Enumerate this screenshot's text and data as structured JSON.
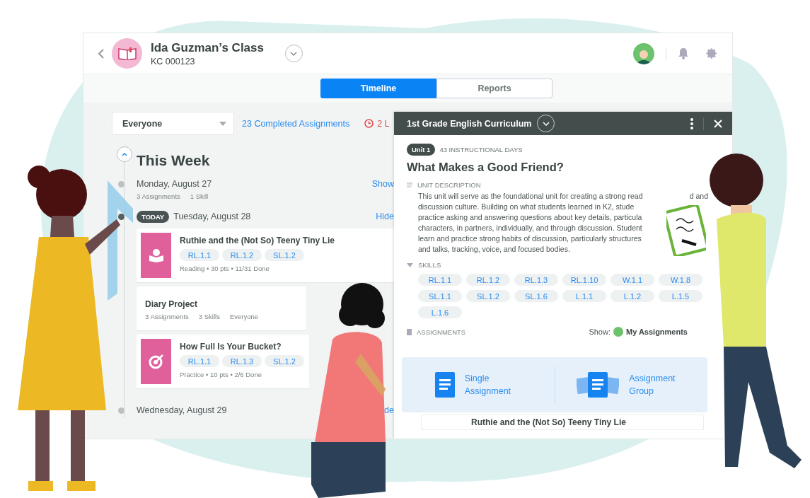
{
  "header": {
    "title": "Ida Guzman’s Class",
    "code": "KC 000123"
  },
  "tabs": [
    {
      "label": "Timeline",
      "selected": true
    },
    {
      "label": "Reports",
      "selected": false
    }
  ],
  "filter": {
    "value": "Everyone"
  },
  "completed_link": "23 Completed Assignments",
  "late_count": "2 L",
  "timeline": {
    "heading": "This Week",
    "days": [
      {
        "date": "Monday, August 27",
        "today": false,
        "toggle": "Show",
        "summary": [
          "3 Assignments",
          "1 Skill"
        ]
      },
      {
        "date": "Tuesday, August 28",
        "today": true,
        "today_label": "TODAY",
        "toggle": "Hide",
        "cards": [
          {
            "kind": "reading",
            "title": "Ruthie and the (Not So) Teeny Tiny Lie",
            "skills": [
              "RL.1.1",
              "RL.1.2",
              "SL.1.2"
            ],
            "meta": "Reading • 30 pts • 11/31 Done"
          },
          {
            "kind": "project",
            "title": "Diary Project",
            "assignments": "3 Assignments",
            "skills_count": "3 Skills",
            "audience": "Everyone"
          },
          {
            "kind": "practice",
            "title": "How Full Is Your Bucket?",
            "skills": [
              "RL.1.1",
              "RL.1.3",
              "SL.1.2"
            ],
            "meta": "Practice • 10 pts • 2/6 Done"
          }
        ]
      },
      {
        "date": "Wednesday, August 29",
        "today": false,
        "toggle": "de"
      }
    ]
  },
  "panel": {
    "title": "1st Grade English Curriculum",
    "unit": "Unit 1",
    "days": "43 INSTRUCTIONAL DAYS",
    "heading": "What Makes a Good Friend?",
    "description_label": "UNIT DESCRIPTION",
    "description_lines": [
      {
        "text": "This unit will serve as the foundational unit for creating a strong read",
        "tail": "d and"
      },
      {
        "text": "discussion culture. Building on what students learned in K2, stude"
      },
      {
        "text": "practice asking and answering questions about key details, particula"
      },
      {
        "text": "characters, in partners, individually, and through discussion. Student"
      },
      {
        "text": "learn and practice strong habits of discussion, particularly structures"
      },
      {
        "text": "and talks, tracking, voice, and focused bodies."
      }
    ],
    "skills_label": "SKILLS",
    "skills": [
      "RL.1.1",
      "RL.1.2",
      "RL.1.3",
      "RL.1.10",
      "W.1.1",
      "W.1.8",
      "SL.1.1",
      "SL.1.2",
      "SL.1.6",
      "L.1.1",
      "L.1.2",
      "L.1.5",
      "L.1.6"
    ],
    "assignments_label": "ASSIGNMENTS",
    "show_label": "Show:",
    "show_value": "My Assignments",
    "assignment_row": "Ruthie and the (Not So) Teeny Tiny Lie"
  },
  "chooser": [
    {
      "kind": "single",
      "label": "Single Assignment"
    },
    {
      "kind": "group",
      "label": "Assignment Group"
    }
  ]
}
